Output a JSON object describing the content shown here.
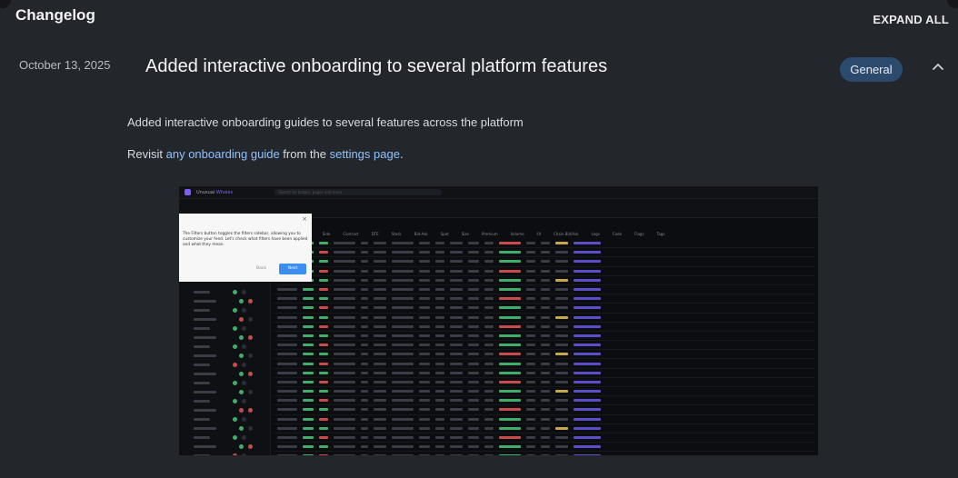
{
  "header": {
    "title": "Changelog",
    "expand_all": "EXPAND ALL"
  },
  "entry": {
    "date": "October 13, 2025",
    "title": "Added interactive onboarding to several platform features",
    "badge": "General",
    "paragraph1": "Added interactive onboarding guides to several features across the platform",
    "p2_prefix": "Revisit ",
    "p2_link1": "any onboarding guide",
    "p2_middle": " from the ",
    "p2_link2": "settings page",
    "p2_suffix": "."
  },
  "screenshot": {
    "brand": "Unusual",
    "brand_accent": "Whales",
    "search_placeholder": "Search for tickers, pages and more",
    "popup_text": "The Filters button toggles the filters sidebar, allowing you to customize your feed. Let's check what filters have been applied and what they mean.",
    "popup_back": "Back",
    "popup_next": "Next",
    "columns": [
      "Time",
      "Ticker",
      "Side",
      "Contract",
      "DTE",
      "Stock",
      "Bid-Ask",
      "Spot",
      "Size",
      "Premium",
      "Volume",
      "OI",
      "Chain Bid/Ask",
      "Legs",
      "Code",
      "Flags",
      "Tags"
    ],
    "row_count": 24
  },
  "colors": {
    "background": "#23262b",
    "badge": "#2c4a6d",
    "link": "#8ec3ff"
  }
}
